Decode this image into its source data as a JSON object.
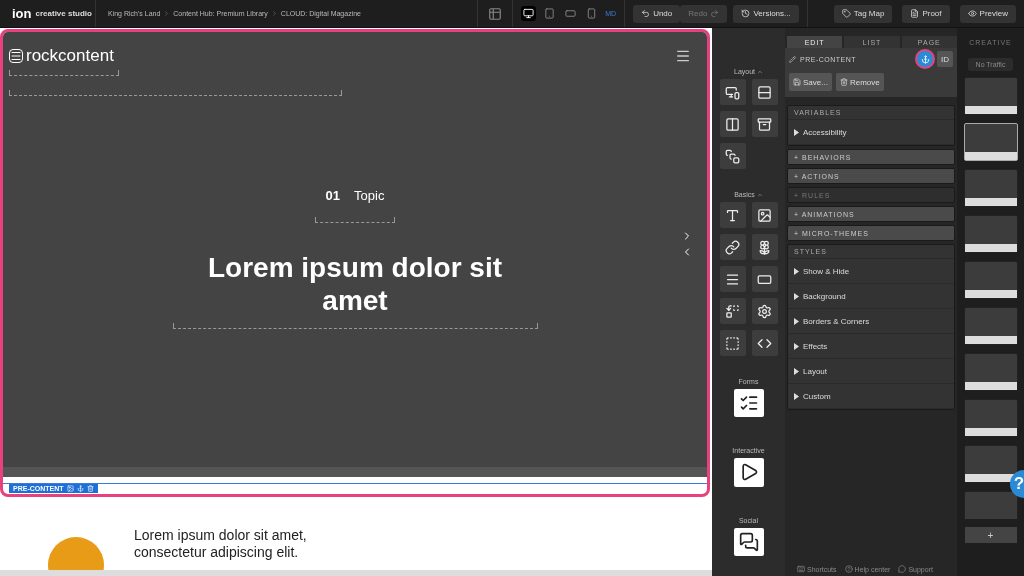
{
  "topbar": {
    "logo": "ion",
    "product": "creative studio",
    "breadcrumbs": [
      "King Rich's Land",
      "Content Hub: Premium Library",
      "CLOUD: Digital Magazine"
    ],
    "devices": [
      {
        "kind": "desktop",
        "selected": true
      },
      {
        "kind": "tablet",
        "selected": false
      },
      {
        "kind": "landscape",
        "selected": false
      },
      {
        "kind": "phone",
        "selected": false
      }
    ],
    "breakpoint": "MD",
    "history": [
      {
        "kind": "undo",
        "label": "Undo",
        "disabled": false
      },
      {
        "kind": "redo",
        "label": "Redo",
        "disabled": true
      }
    ],
    "buttons": [
      {
        "kind": "versions",
        "label": "Versions..."
      },
      {
        "kind": "tag",
        "label": "Tag Map"
      },
      {
        "kind": "proof",
        "label": "Proof"
      },
      {
        "kind": "preview",
        "label": "Preview"
      }
    ]
  },
  "canvas": {
    "annotated": true,
    "brand": "rockcontent",
    "number": "01",
    "topic": "Topic",
    "headline": "Lorem ipsum dolor sit amet",
    "section_label": "PRE-CONTENT",
    "body_text": "Lorem ipsum dolor sit amet, consectetur adipiscing elit."
  },
  "widgets": [
    {
      "label": "Layout",
      "expanded": true,
      "items": [
        {
          "kind": "responsive"
        },
        {
          "kind": "rows"
        },
        {
          "kind": "columns"
        },
        {
          "kind": "container"
        },
        {
          "kind": "overlay"
        }
      ]
    },
    {
      "label": "Basics",
      "expanded": true,
      "items": [
        {
          "kind": "text"
        },
        {
          "kind": "image"
        },
        {
          "kind": "link"
        },
        {
          "kind": "icon"
        },
        {
          "kind": "list"
        },
        {
          "kind": "divider"
        },
        {
          "kind": "swap"
        },
        {
          "kind": "settings"
        },
        {
          "kind": "placeholder"
        },
        {
          "kind": "code"
        }
      ]
    },
    {
      "label": "Forms",
      "items": [
        {
          "kind": "form"
        }
      ]
    },
    {
      "label": "Interactive",
      "items": [
        {
          "kind": "video"
        }
      ]
    },
    {
      "label": "Social",
      "items": [
        {
          "kind": "social"
        }
      ]
    }
  ],
  "properties": {
    "tabs": [
      {
        "label": "EDIT",
        "selected": true
      },
      {
        "label": "LIST",
        "selected": false
      },
      {
        "label": "PAGE",
        "selected": false
      }
    ],
    "element": "PRE-CONTENT",
    "anchor": {
      "on": true,
      "annotated": true
    },
    "id_label": "ID",
    "actions": [
      {
        "kind": "save",
        "label": "Save..."
      },
      {
        "kind": "remove",
        "label": "Remove"
      }
    ],
    "sections": [
      {
        "kind": "header",
        "label": "VARIABLES",
        "items": [
          "Accessibility"
        ]
      },
      {
        "kind": "bar",
        "label": "+ BEHAVIORS",
        "disabled": false
      },
      {
        "kind": "bar",
        "label": "+ ACTIONS",
        "disabled": false
      },
      {
        "kind": "bar",
        "label": "+ RULES",
        "disabled": true
      },
      {
        "kind": "bar",
        "label": "+ ANIMATIONS",
        "disabled": false
      },
      {
        "kind": "bar",
        "label": "+ MICRO-THEMES",
        "disabled": false
      },
      {
        "kind": "header",
        "label": "STYLES",
        "items": [
          "Show & Hide",
          "Background",
          "Borders & Corners",
          "Effects",
          "Layout",
          "Custom"
        ]
      }
    ]
  },
  "creative": {
    "tab": "CREATIVE",
    "traffic": "No Traffic",
    "thumbnails": [
      {
        "selected": false
      },
      {
        "selected": true
      },
      {
        "selected": false
      },
      {
        "selected": false
      },
      {
        "selected": false
      },
      {
        "selected": false
      },
      {
        "selected": false
      },
      {
        "selected": false
      },
      {
        "selected": false
      },
      {
        "selected": false
      }
    ],
    "add": "+"
  },
  "footer": [
    {
      "kind": "keyboard",
      "label": "Shortcuts"
    },
    {
      "kind": "help",
      "label": "Help center"
    },
    {
      "kind": "chat",
      "label": "Support"
    }
  ],
  "help_button": "?"
}
